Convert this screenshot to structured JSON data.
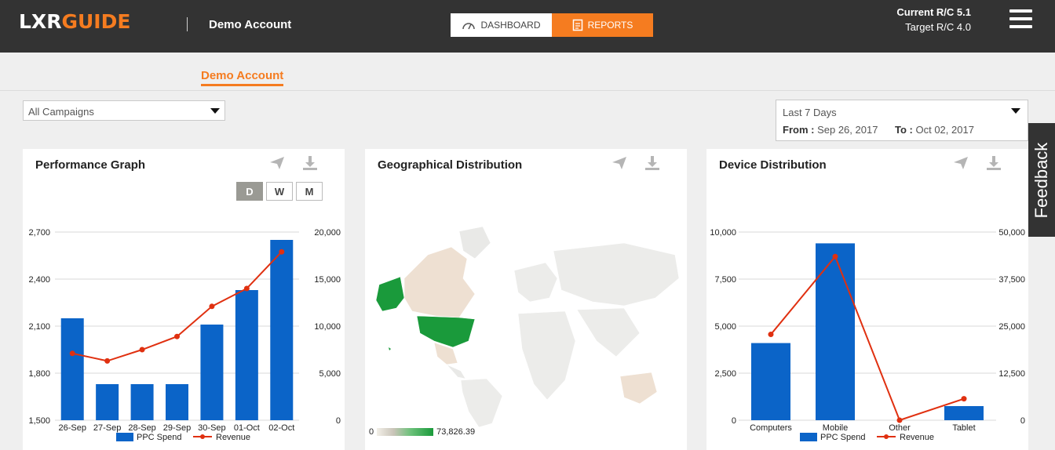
{
  "header": {
    "logo_part1": "LXR",
    "logo_part2": "GUIDE",
    "account_name": "Demo Account",
    "tabs": [
      {
        "label": "DASHBOARD",
        "active": false
      },
      {
        "label": "REPORTS",
        "active": true
      }
    ],
    "current_rc": "Current R/C  5.1",
    "target_rc": "Target R/C 4.0"
  },
  "subnav": {
    "active_tab": "Demo Account"
  },
  "filters": {
    "campaign_selected": "All Campaigns",
    "date_range": "Last 7 Days",
    "from_label": "From :",
    "from_value": "Sep 26, 2017",
    "to_label": "To :",
    "to_value": "Oct 02, 2017"
  },
  "feedback_label": "Feedback",
  "colors": {
    "brand_orange": "#f57c20",
    "header_bg": "#333333",
    "bar_blue": "#0b64c8",
    "line_red": "#e03010",
    "geo_green": "#1a9a3b"
  },
  "cards": [
    {
      "title": "Performance Graph"
    },
    {
      "title": "Geographical Distribution"
    },
    {
      "title": "Device Distribution"
    }
  ],
  "granularity": [
    "D",
    "W",
    "M"
  ],
  "granularity_active": "D",
  "geo_legend": {
    "min": "0",
    "max": "73,826.39"
  },
  "chart_data": [
    {
      "type": "bar",
      "title": "Performance Graph",
      "categories": [
        "26-Sep",
        "27-Sep",
        "28-Sep",
        "29-Sep",
        "30-Sep",
        "01-Oct",
        "02-Oct"
      ],
      "series": [
        {
          "name": "PPC Spend",
          "type": "bar",
          "axis": "left",
          "values": [
            2150,
            1730,
            1730,
            1730,
            2110,
            2330,
            2650
          ]
        },
        {
          "name": "Revenue",
          "type": "line",
          "axis": "right",
          "values": [
            7100,
            6300,
            7500,
            8900,
            12100,
            14000,
            17900
          ]
        }
      ],
      "y_left": {
        "min": 1500,
        "max": 2700,
        "ticks": [
          "1,500",
          "1,800",
          "2,100",
          "2,400",
          "2,700"
        ]
      },
      "y_right": {
        "min": 0,
        "max": 20000,
        "ticks": [
          "0",
          "5,000",
          "10,000",
          "15,000",
          "20,000"
        ]
      },
      "grid": true,
      "legend_position": "bottom"
    },
    {
      "type": "bar",
      "title": "Device Distribution",
      "categories": [
        "Computers",
        "Mobile",
        "Other",
        "Tablet"
      ],
      "series": [
        {
          "name": "PPC Spend",
          "type": "bar",
          "axis": "left",
          "values": [
            4100,
            9400,
            0,
            750
          ]
        },
        {
          "name": "Revenue",
          "type": "line",
          "axis": "right",
          "values": [
            22800,
            43500,
            0,
            5700
          ]
        }
      ],
      "y_left": {
        "min": 0,
        "max": 10000,
        "ticks": [
          "0",
          "2,500",
          "5,000",
          "7,500",
          "10,000"
        ]
      },
      "y_right": {
        "min": 0,
        "max": 50000,
        "ticks": [
          "0",
          "12,500",
          "25,000",
          "37,500",
          "50,000"
        ]
      },
      "grid": true,
      "legend_position": "bottom"
    }
  ]
}
